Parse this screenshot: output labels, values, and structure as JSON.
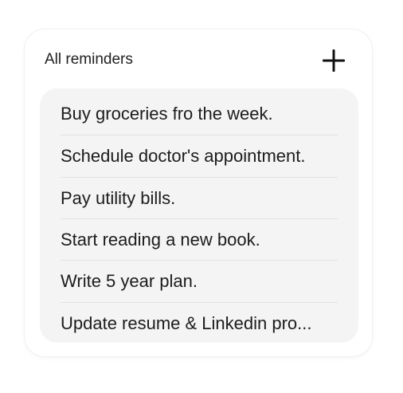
{
  "widget": {
    "title": "All reminders",
    "add_icon": "plus-icon",
    "items": [
      {
        "text": "Buy groceries fro the week."
      },
      {
        "text": "Schedule doctor's appointment."
      },
      {
        "text": "Pay utility bills."
      },
      {
        "text": "Start reading a new book."
      },
      {
        "text": "Write 5 year plan."
      },
      {
        "text": "Update resume & Linkedin pro..."
      }
    ]
  },
  "colors": {
    "list_background": "#f4f4f4",
    "text": "#1c1c1c",
    "divider": "#e2e2e2"
  }
}
